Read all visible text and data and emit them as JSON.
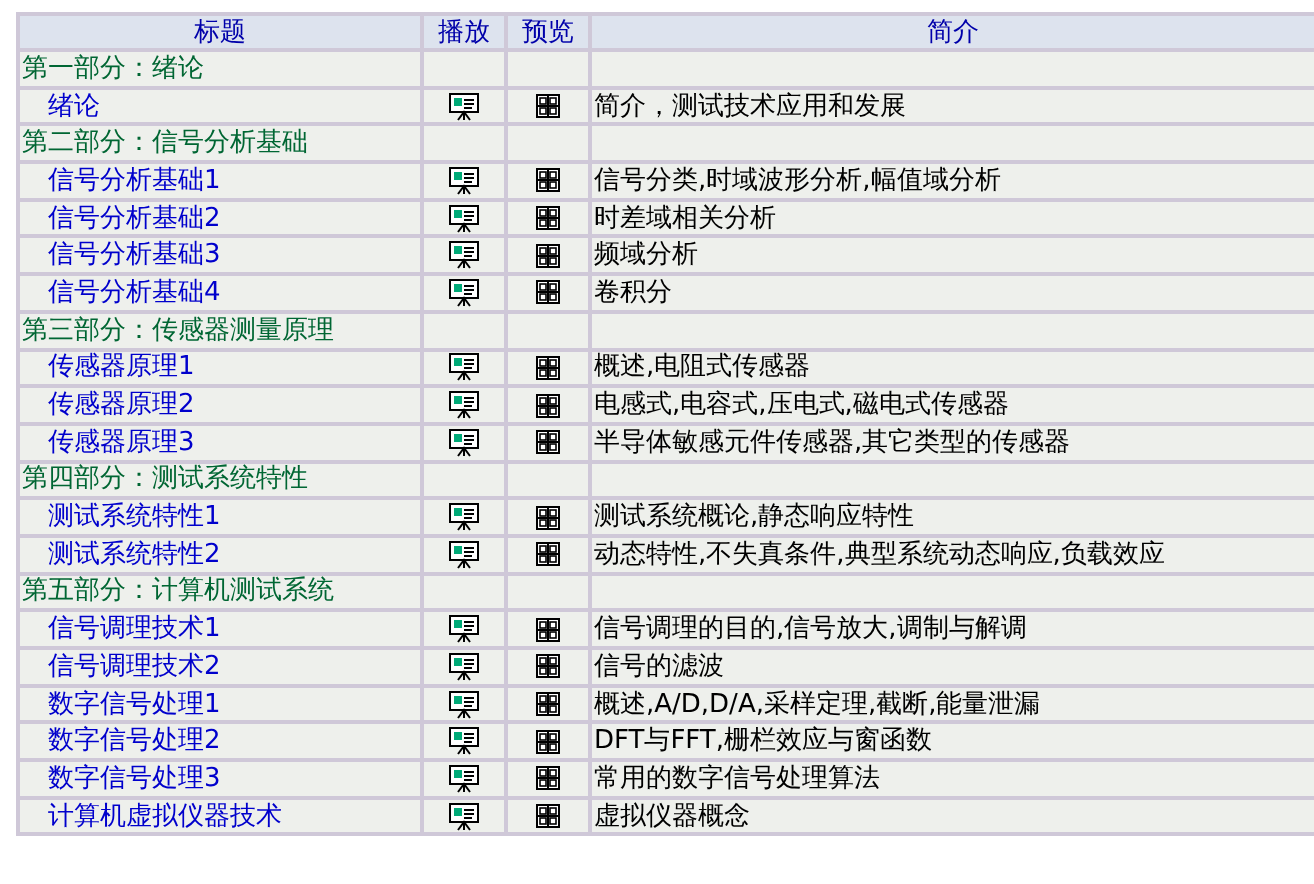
{
  "columns": [
    "标题",
    "播放",
    "预览",
    "简介"
  ],
  "sections": [
    {
      "title": "第一部分：绪论",
      "lessons": [
        {
          "title": "绪论",
          "summary": "简介，测试技术应用和发展"
        }
      ]
    },
    {
      "title": "第二部分：信号分析基础",
      "lessons": [
        {
          "title": "信号分析基础1",
          "summary": "信号分类,时域波形分析,幅值域分析"
        },
        {
          "title": "信号分析基础2",
          "summary": "时差域相关分析"
        },
        {
          "title": "信号分析基础3",
          "summary": "频域分析"
        },
        {
          "title": "信号分析基础4",
          "summary": "卷积分"
        }
      ]
    },
    {
      "title": "第三部分：传感器测量原理",
      "lessons": [
        {
          "title": "传感器原理1",
          "summary": "概述,电阻式传感器"
        },
        {
          "title": "传感器原理2",
          "summary": "电感式,电容式,压电式,磁电式传感器"
        },
        {
          "title": "传感器原理3",
          "summary": "半导体敏感元件传感器,其它类型的传感器"
        }
      ]
    },
    {
      "title": "第四部分：测试系统特性",
      "lessons": [
        {
          "title": "测试系统特性1",
          "summary": "测试系统概论,静态响应特性"
        },
        {
          "title": "测试系统特性2",
          "summary": "动态特性,不失真条件,典型系统动态响应,负载效应"
        }
      ]
    },
    {
      "title": "第五部分：计算机测试系统",
      "lessons": [
        {
          "title": "信号调理技术1",
          "summary": "信号调理的目的,信号放大,调制与解调"
        },
        {
          "title": "信号调理技术2",
          "summary": "信号的滤波"
        },
        {
          "title": "数字信号处理1",
          "summary": "概述,A/D,D/A,采样定理,截断,能量泄漏"
        },
        {
          "title": "数字信号处理2",
          "summary": "DFT与FFT,栅栏效应与窗函数"
        },
        {
          "title": "数字信号处理3",
          "summary": "常用的数字信号处理算法"
        },
        {
          "title": "计算机虚拟仪器技术",
          "summary": "虚拟仪器概念"
        }
      ]
    }
  ]
}
